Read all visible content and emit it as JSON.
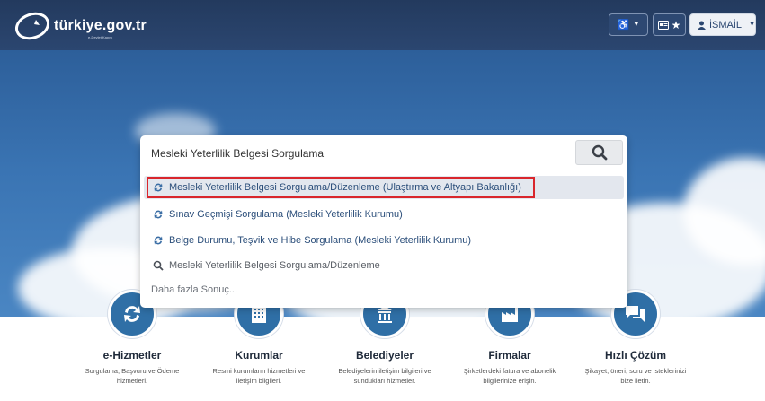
{
  "header": {
    "logo_text": "türkiye.gov.tr",
    "logo_subtext": "e-Devlet Kapısı",
    "accessibility_label": "♿",
    "user_label": "İSMAİL"
  },
  "search": {
    "query": "Mesleki Yeterlilik Belgesi Sorgulama",
    "suggestions": [
      {
        "label": "Mesleki Yeterlilik Belgesi Sorgulama/Düzenleme (Ulaştırma ve Altyapı Bakanlığı)"
      },
      {
        "label": "Sınav Geçmişi Sorgulama (Mesleki Yeterlilik Kurumu)"
      },
      {
        "label": "Belge Durumu, Teşvik ve Hibe Sorgulama (Mesleki Yeterlilik Kurumu)"
      },
      {
        "label": "Mesleki Yeterlilik Belgesi Sorgulama/Düzenleme"
      }
    ],
    "more_label": "Daha fazla Sonuç..."
  },
  "categories": [
    {
      "title": "e-Hizmetler",
      "desc": "Sorgulama, Başvuru ve Ödeme hizmetleri."
    },
    {
      "title": "Kurumlar",
      "desc": "Resmi kurumların hizmetleri ve iletişim bilgileri."
    },
    {
      "title": "Belediyeler",
      "desc": "Belediyelerin iletişim bilgileri ve sundukları hizmetler."
    },
    {
      "title": "Firmalar",
      "desc": "Şirketlerdeki fatura ve abonelik bilgilerinize erişin."
    },
    {
      "title": "Hızlı Çözüm",
      "desc": "Şikayet, öneri, soru ve isteklerinizi bize iletin."
    }
  ],
  "colors": {
    "header_bg": "#233a5e",
    "accent": "#2f6fa6",
    "highlight_border": "#d9262c"
  }
}
